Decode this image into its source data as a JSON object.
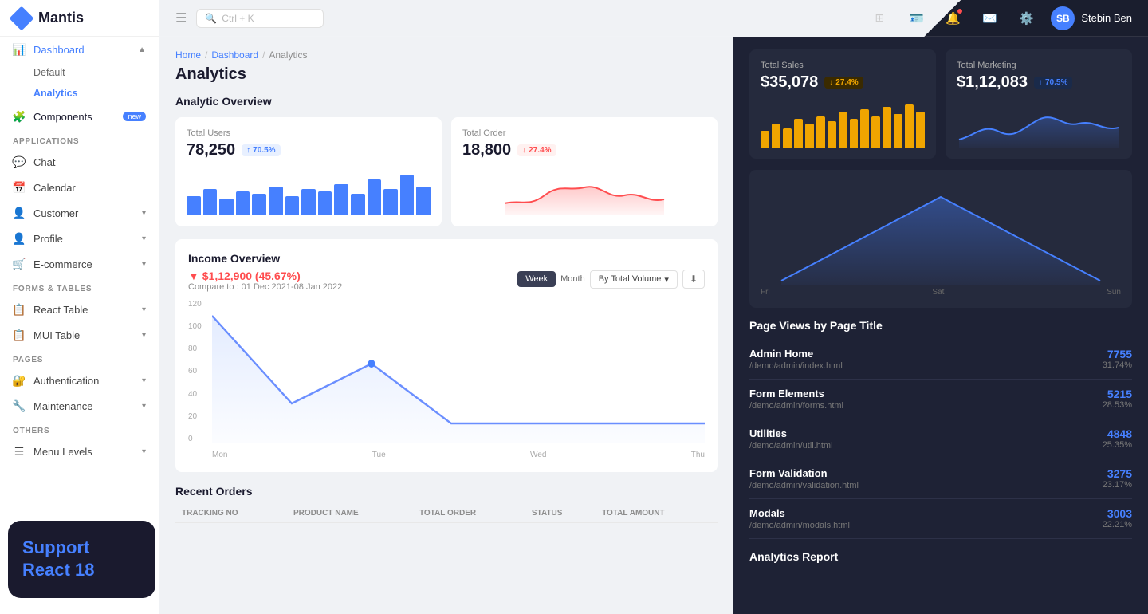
{
  "app": {
    "name": "Mantis"
  },
  "topbar": {
    "search_placeholder": "Ctrl + K",
    "user_name": "Stebin Ben",
    "user_initials": "SB"
  },
  "sidebar": {
    "logo": "Mantis",
    "nav": [
      {
        "id": "dashboard",
        "label": "Dashboard",
        "icon": "📊",
        "type": "parent",
        "open": true,
        "children": [
          {
            "id": "default",
            "label": "Default"
          },
          {
            "id": "analytics",
            "label": "Analytics",
            "active": true
          }
        ]
      },
      {
        "id": "components",
        "label": "Components",
        "icon": "🧩",
        "type": "parent",
        "badge": "new"
      },
      {
        "id": "apps-label",
        "label": "Applications",
        "type": "section"
      },
      {
        "id": "chat",
        "label": "Chat",
        "icon": "💬"
      },
      {
        "id": "calendar",
        "label": "Calendar",
        "icon": "📅"
      },
      {
        "id": "customer",
        "label": "Customer",
        "icon": "👤",
        "arrow": true
      },
      {
        "id": "profile",
        "label": "Profile",
        "icon": "👤",
        "arrow": true
      },
      {
        "id": "ecommerce",
        "label": "E-commerce",
        "icon": "🛒",
        "arrow": true
      },
      {
        "id": "forms-label",
        "label": "Forms & Tables",
        "type": "section"
      },
      {
        "id": "react-table",
        "label": "React Table",
        "icon": "📋",
        "arrow": true
      },
      {
        "id": "mui-table",
        "label": "MUI Table",
        "icon": "📋",
        "arrow": true
      },
      {
        "id": "pages-label",
        "label": "Pages",
        "type": "section"
      },
      {
        "id": "authentication",
        "label": "Authentication",
        "icon": "🔐",
        "arrow": true
      },
      {
        "id": "maintenance",
        "label": "Maintenance",
        "icon": "🔧",
        "arrow": true
      },
      {
        "id": "other-label",
        "label": "Others",
        "type": "section"
      },
      {
        "id": "menu-levels",
        "label": "Menu Levels",
        "icon": "☰",
        "arrow": true
      }
    ]
  },
  "breadcrumb": {
    "items": [
      "Home",
      "Dashboard",
      "Analytics"
    ]
  },
  "page": {
    "title": "Analytics",
    "analytic_overview_title": "Analytic Overview",
    "income_overview_title": "Income Overview",
    "recent_orders_title": "Recent Orders"
  },
  "analytics_cards": [
    {
      "id": "total-users",
      "label": "Total Users",
      "value": "78,250",
      "badge": "70.5%",
      "badge_type": "up-blue",
      "chart_type": "bar-blue",
      "bars": [
        40,
        55,
        35,
        50,
        45,
        60,
        40,
        55,
        50,
        65,
        45,
        70,
        55,
        80,
        60
      ]
    },
    {
      "id": "total-order",
      "label": "Total Order",
      "value": "18,800",
      "badge": "27.4%",
      "badge_type": "down-red",
      "chart_type": "area-red"
    }
  ],
  "dark_cards": [
    {
      "id": "total-sales",
      "label": "Total Sales",
      "value": "$35,078",
      "badge": "27.4%",
      "badge_type": "down-orange",
      "chart_type": "bar-yellow",
      "bars": [
        30,
        45,
        35,
        55,
        45,
        60,
        50,
        70,
        55,
        75,
        60,
        80,
        65,
        85,
        70
      ]
    },
    {
      "id": "total-marketing",
      "label": "Total Marketing",
      "value": "$1,12,083",
      "badge": "70.5%",
      "badge_type": "up-blue",
      "chart_type": "area-blue"
    }
  ],
  "income_overview": {
    "amount": "▼ $1,12,900 (45.67%)",
    "compare": "Compare to : 01 Dec 2021-08 Jan 2022",
    "y_labels": [
      "120",
      "100",
      "80",
      "60",
      "40",
      "20",
      "0"
    ],
    "x_labels": [
      "Mon",
      "Tue",
      "Wed",
      "Thu",
      "Fri",
      "Sat",
      "Sun"
    ],
    "week_btn": "Week",
    "month_btn": "Month",
    "volume_btn": "By Total Volume"
  },
  "page_views": {
    "title": "Page Views by Page Title",
    "items": [
      {
        "name": "Admin Home",
        "path": "/demo/admin/index.html",
        "count": "7755",
        "pct": "31.74%"
      },
      {
        "name": "Form Elements",
        "path": "/demo/admin/forms.html",
        "count": "5215",
        "pct": "28.53%"
      },
      {
        "name": "Utilities",
        "path": "/demo/admin/util.html",
        "count": "4848",
        "pct": "25.35%"
      },
      {
        "name": "Form Validation",
        "path": "/demo/admin/validation.html",
        "count": "3275",
        "pct": "23.17%"
      },
      {
        "name": "Modals",
        "path": "/demo/admin/modals.html",
        "count": "3003",
        "pct": "22.21%"
      }
    ]
  },
  "analytics_report": {
    "title": "Analytics Report"
  },
  "support_popup": {
    "line1": "Support",
    "line2": "React 18"
  },
  "orders_columns": [
    "TRACKING NO",
    "PRODUCT NAME",
    "TOTAL ORDER",
    "STATUS",
    "TOTAL AMOUNT"
  ]
}
